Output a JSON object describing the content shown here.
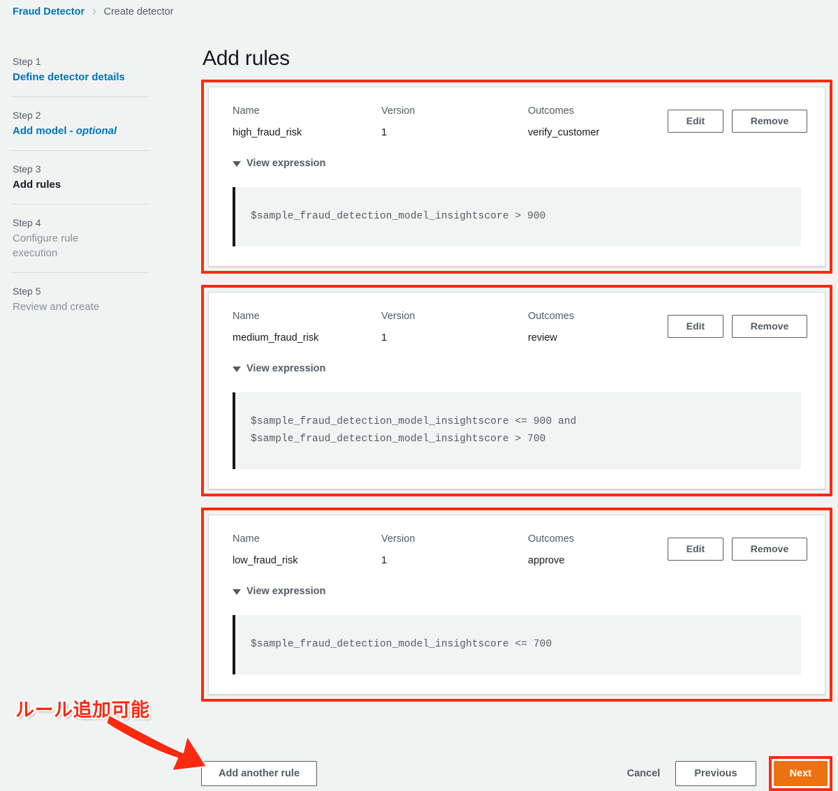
{
  "breadcrumb": {
    "root": "Fraud Detector",
    "separator": "›",
    "current": "Create detector"
  },
  "sidebar": {
    "steps": [
      {
        "num": "Step 1",
        "label": "Define detector details",
        "state": "link"
      },
      {
        "num": "Step 2",
        "label": "Add model - ",
        "optional": "optional",
        "state": "link"
      },
      {
        "num": "Step 3",
        "label": "Add rules",
        "state": "current"
      },
      {
        "num": "Step 4",
        "label": "Configure rule execution",
        "state": "muted"
      },
      {
        "num": "Step 5",
        "label": "Review and create",
        "state": "muted"
      }
    ]
  },
  "main": {
    "title": "Add rules",
    "labels": {
      "name": "Name",
      "version": "Version",
      "outcomes": "Outcomes",
      "edit": "Edit",
      "remove": "Remove",
      "view_expression": "View expression"
    },
    "rules": [
      {
        "name": "high_fraud_risk",
        "version": "1",
        "outcomes": "verify_customer",
        "expression": "$sample_fraud_detection_model_insightscore > 900"
      },
      {
        "name": "medium_fraud_risk",
        "version": "1",
        "outcomes": "review",
        "expression": "$sample_fraud_detection_model_insightscore <= 900 and\n$sample_fraud_detection_model_insightscore > 700"
      },
      {
        "name": "low_fraud_risk",
        "version": "1",
        "outcomes": "approve",
        "expression": "$sample_fraud_detection_model_insightscore <= 700"
      }
    ]
  },
  "footer": {
    "add_another_rule": "Add another rule",
    "cancel": "Cancel",
    "previous": "Previous",
    "next": "Next"
  },
  "annotation": {
    "text": "ルール追加可能"
  },
  "colors": {
    "highlight_red": "#fc2a11",
    "link_blue": "#0073bb",
    "next_orange": "#ec7211",
    "page_bg": "#f1f3f3"
  }
}
